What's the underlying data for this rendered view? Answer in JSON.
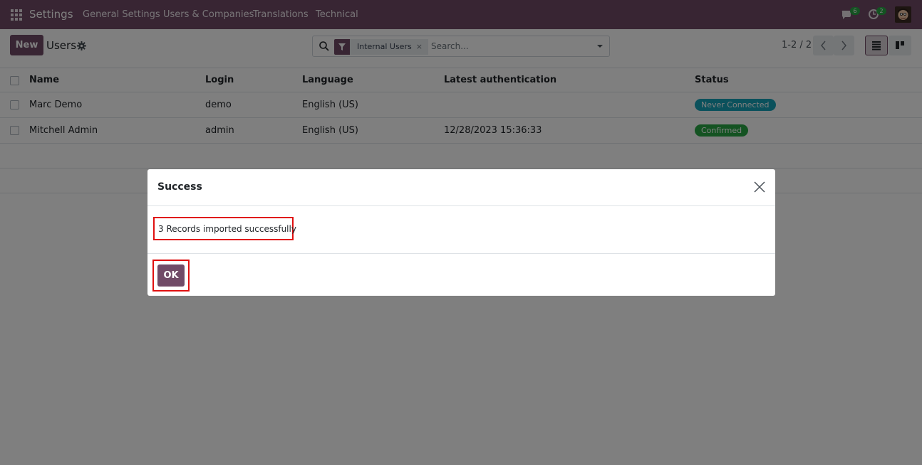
{
  "navbar": {
    "brand": "Settings",
    "menu": [
      "General Settings",
      "Users & Companies",
      "Translations",
      "Technical"
    ],
    "messages_count": "6",
    "activities_count": "2",
    "bg_color": "#714b67"
  },
  "control_panel": {
    "new_button": "New",
    "breadcrumb": "Users",
    "search": {
      "facet": "Internal Users",
      "facet_remove": "×",
      "placeholder": "Search..."
    },
    "pager": "1-2 / 2"
  },
  "list": {
    "columns": [
      "Name",
      "Login",
      "Language",
      "Latest authentication",
      "Status"
    ],
    "rows": [
      {
        "name": "Marc Demo",
        "login": "demo",
        "language": "English (US)",
        "latest_auth": "",
        "status": "Never Connected",
        "status_color": "#17a2b8"
      },
      {
        "name": "Mitchell Admin",
        "login": "admin",
        "language": "English (US)",
        "latest_auth": "12/28/2023 15:36:33",
        "status": "Confirmed",
        "status_color": "#28a745"
      }
    ]
  },
  "dialog": {
    "title": "Success",
    "message": "3 Records imported successfully",
    "ok_button": "OK"
  }
}
